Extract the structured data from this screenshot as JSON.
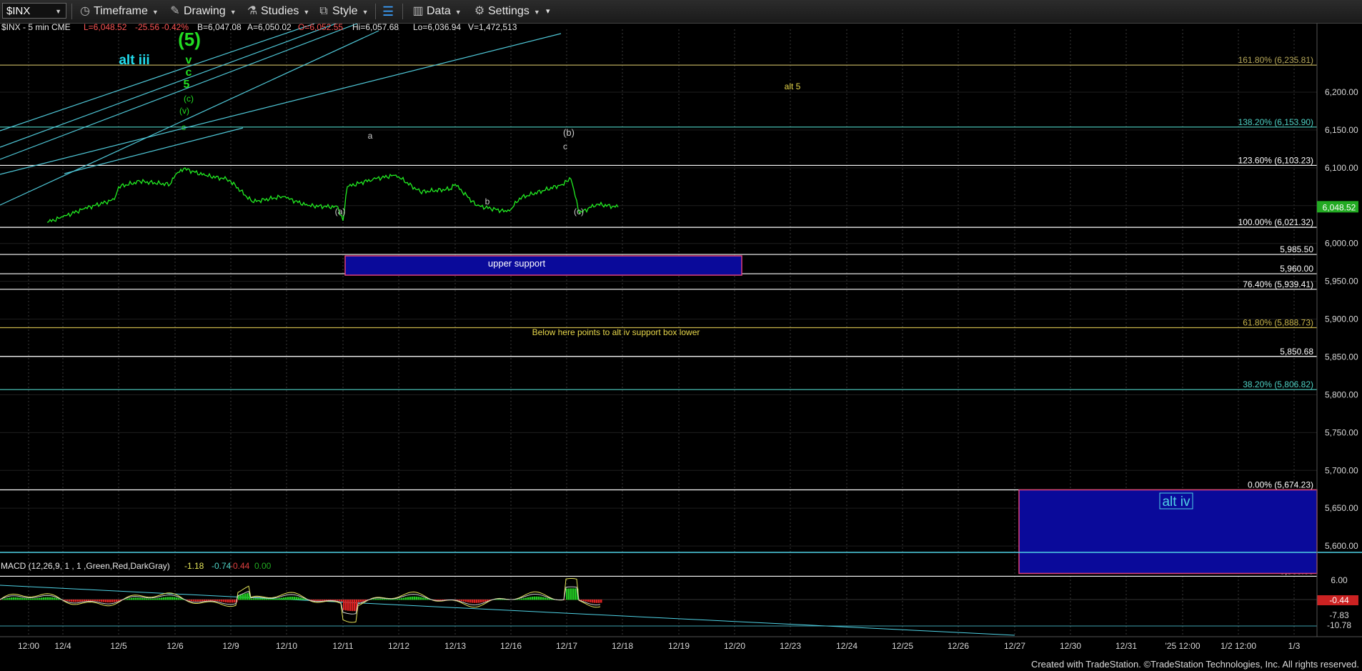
{
  "toolbar": {
    "symbol": "$INX",
    "timeframe": "Timeframe",
    "drawing": "Drawing",
    "studies": "Studies",
    "style": "Style",
    "data": "Data",
    "settings": "Settings"
  },
  "header": {
    "symbol_line": "$INX - 5 min  CME",
    "last": "L=6,048.52",
    "change": "-25.56",
    "change_pct": "-0.42%",
    "bid": "B=6,047.08",
    "ask": "A=6,050.02",
    "open": "O=6,052.55",
    "high": "Hi=6,057.68",
    "low": "Lo=6,036.94",
    "volume": "V=1,472,513"
  },
  "chart_data": {
    "type": "line",
    "interval": "5 min",
    "x_labels": [
      "12:00",
      "12/4",
      "12/5",
      "12/6",
      "12/9",
      "12/10",
      "12/11",
      "12/12",
      "12/13",
      "12/16",
      "12/17",
      "12/18",
      "12/19",
      "12/20",
      "12/23",
      "12/24",
      "12/25",
      "12/26",
      "12/27",
      "12/30",
      "12/31",
      "'25 12:00",
      "1/2 12:00",
      "1/3"
    ],
    "ylim": [
      5560,
      6260
    ],
    "y_ticks": [
      6200,
      6150,
      6100,
      6050,
      6000,
      5950,
      5900,
      5850,
      5800,
      5750,
      5700,
      5650,
      5600
    ],
    "y_tick_labels": [
      "6,200.00",
      "6,150.00",
      "6,100.00",
      "6,050.00",
      "6,000.00",
      "5,950.00",
      "5,900.00",
      "5,850.00",
      "5,800.00",
      "5,750.00",
      "5,700.00",
      "5,650.00",
      "5,600.00"
    ],
    "last_price": 6048.52,
    "last_price_label": "6,048.52",
    "price_series": {
      "name": "$INX",
      "color": "#22ee22",
      "points": [
        [
          "12/3 15:00",
          6028
        ],
        [
          "12/4 09:30",
          6035
        ],
        [
          "12/4 12:00",
          6046
        ],
        [
          "12/4 15:30",
          6058
        ],
        [
          "12/5 09:30",
          6075
        ],
        [
          "12/5 12:00",
          6082
        ],
        [
          "12/5 15:30",
          6078
        ],
        [
          "12/6 09:30",
          6090
        ],
        [
          "12/6 10:30",
          6099
        ],
        [
          "12/6 13:00",
          6090
        ],
        [
          "12/6 15:30",
          6085
        ],
        [
          "12/9 09:30",
          6082
        ],
        [
          "12/9 12:00",
          6055
        ],
        [
          "12/9 15:30",
          6062
        ],
        [
          "12/10 09:30",
          6060
        ],
        [
          "12/10 12:00",
          6050
        ],
        [
          "12/10 15:30",
          6048
        ],
        [
          "12/11 09:00",
          6045
        ],
        [
          "12/11 09:30",
          6030
        ],
        [
          "12/11 10:00",
          6075
        ],
        [
          "12/11 13:00",
          6085
        ],
        [
          "12/11 15:30",
          6090
        ],
        [
          "12/12 09:30",
          6088
        ],
        [
          "12/12 12:00",
          6068
        ],
        [
          "12/12 15:30",
          6072
        ],
        [
          "12/13 09:30",
          6078
        ],
        [
          "12/13 12:00",
          6050
        ],
        [
          "12/13 15:30",
          6042
        ],
        [
          "12/16 09:30",
          6045
        ],
        [
          "12/16 10:30",
          6060
        ],
        [
          "12/16 15:30",
          6078
        ],
        [
          "12/17 09:30",
          6082
        ],
        [
          "12/17 10:00",
          6085
        ],
        [
          "12/17 11:00",
          6040
        ],
        [
          "12/17 13:00",
          6052
        ],
        [
          "12/17 15:30",
          6048
        ]
      ]
    },
    "horizontal_levels": [
      {
        "value": 6235.81,
        "label": "161.80% (6,235.81)",
        "color": "#b8a95a"
      },
      {
        "value": 6153.9,
        "label": "138.20% (6,153.90)",
        "color": "#4fd3c6"
      },
      {
        "value": 6103.23,
        "label": "123.60% (6,103.23)",
        "color": "#ffffff"
      },
      {
        "value": 6021.32,
        "label": "100.00% (6,021.32)",
        "color": "#ffffff"
      },
      {
        "value": 5985.5,
        "label": "5,985.50",
        "color": "#ffffff"
      },
      {
        "value": 5960.0,
        "label": "5,960.00",
        "color": "#ffffff"
      },
      {
        "value": 5939.41,
        "label": "76.40% (5,939.41)",
        "color": "#ffffff"
      },
      {
        "value": 5888.73,
        "label": "61.80% (5,888.73)",
        "color": "#c8b44a"
      },
      {
        "value": 5850.68,
        "label": "5,850.68",
        "color": "#ffffff"
      },
      {
        "value": 5806.82,
        "label": "38.20% (5,806.82)",
        "color": "#4fd3c6"
      },
      {
        "value": 5674.23,
        "label": "0.00% (5,674.23)",
        "color": "#ffffff"
      },
      {
        "value": 5560.0,
        "label": "5,560.00",
        "color": "#ffffff"
      }
    ],
    "support_boxes": [
      {
        "label": "upper support",
        "top": 5985.5,
        "bottom": 5960.0,
        "start": "12/11",
        "end": "12/20"
      },
      {
        "label": "alt iv",
        "top": 5674.23,
        "bottom": 5560.0,
        "start": "12/27",
        "end": "1/3"
      }
    ],
    "wave_labels": [
      {
        "text": "alt iii",
        "color": "#22ddee"
      },
      {
        "text": "(5)",
        "color": "#22dd22"
      },
      {
        "text": "v",
        "color": "#22dd22"
      },
      {
        "text": "c",
        "color": "#22dd22"
      },
      {
        "text": "5",
        "color": "#22dd22"
      },
      {
        "text": "(c)",
        "color": "#22dd22"
      },
      {
        "text": "(v)",
        "color": "#22dd22"
      },
      {
        "text": "c",
        "color": "#22dd22"
      },
      {
        "text": "a",
        "color": "#cccccc"
      },
      {
        "text": "(a)",
        "color": "#cccccc"
      },
      {
        "text": "b",
        "color": "#cccccc"
      },
      {
        "text": "(b)",
        "color": "#cccccc"
      },
      {
        "text": "c",
        "color": "#cccccc"
      },
      {
        "text": "(c)",
        "color": "#cccccc"
      },
      {
        "text": "alt 5",
        "color": "#e6d64a"
      }
    ],
    "note": "Below here points to alt iv support box lower",
    "macd": {
      "title": "MACD (12,26,9, 1 , 1 ,Green,Red,DarkGray)",
      "values": [
        "-1.18",
        "-0.74",
        "-0.44",
        "0.00"
      ],
      "value_colors": [
        "#e6e65a",
        "#4fd3c6",
        "#e04040",
        "#22aa22"
      ],
      "ylim": [
        -10.78,
        6.0
      ],
      "y_tick_labels": [
        "6.00",
        "-7.83",
        "-10.78"
      ],
      "current_label": "-0.44"
    }
  },
  "footer": "Created with TradeStation. ©TradeStation Technologies, Inc. All rights reserved."
}
